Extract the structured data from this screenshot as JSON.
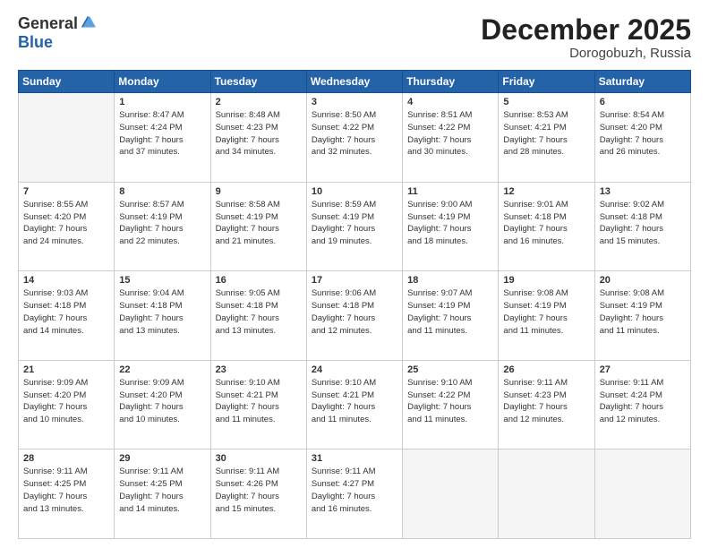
{
  "header": {
    "logo_line1": "General",
    "logo_line2": "Blue",
    "month": "December 2025",
    "location": "Dorogobuzh, Russia"
  },
  "weekdays": [
    "Sunday",
    "Monday",
    "Tuesday",
    "Wednesday",
    "Thursday",
    "Friday",
    "Saturday"
  ],
  "weeks": [
    [
      {
        "day": "",
        "info": ""
      },
      {
        "day": "1",
        "info": "Sunrise: 8:47 AM\nSunset: 4:24 PM\nDaylight: 7 hours\nand 37 minutes."
      },
      {
        "day": "2",
        "info": "Sunrise: 8:48 AM\nSunset: 4:23 PM\nDaylight: 7 hours\nand 34 minutes."
      },
      {
        "day": "3",
        "info": "Sunrise: 8:50 AM\nSunset: 4:22 PM\nDaylight: 7 hours\nand 32 minutes."
      },
      {
        "day": "4",
        "info": "Sunrise: 8:51 AM\nSunset: 4:22 PM\nDaylight: 7 hours\nand 30 minutes."
      },
      {
        "day": "5",
        "info": "Sunrise: 8:53 AM\nSunset: 4:21 PM\nDaylight: 7 hours\nand 28 minutes."
      },
      {
        "day": "6",
        "info": "Sunrise: 8:54 AM\nSunset: 4:20 PM\nDaylight: 7 hours\nand 26 minutes."
      }
    ],
    [
      {
        "day": "7",
        "info": "Sunrise: 8:55 AM\nSunset: 4:20 PM\nDaylight: 7 hours\nand 24 minutes."
      },
      {
        "day": "8",
        "info": "Sunrise: 8:57 AM\nSunset: 4:19 PM\nDaylight: 7 hours\nand 22 minutes."
      },
      {
        "day": "9",
        "info": "Sunrise: 8:58 AM\nSunset: 4:19 PM\nDaylight: 7 hours\nand 21 minutes."
      },
      {
        "day": "10",
        "info": "Sunrise: 8:59 AM\nSunset: 4:19 PM\nDaylight: 7 hours\nand 19 minutes."
      },
      {
        "day": "11",
        "info": "Sunrise: 9:00 AM\nSunset: 4:19 PM\nDaylight: 7 hours\nand 18 minutes."
      },
      {
        "day": "12",
        "info": "Sunrise: 9:01 AM\nSunset: 4:18 PM\nDaylight: 7 hours\nand 16 minutes."
      },
      {
        "day": "13",
        "info": "Sunrise: 9:02 AM\nSunset: 4:18 PM\nDaylight: 7 hours\nand 15 minutes."
      }
    ],
    [
      {
        "day": "14",
        "info": "Sunrise: 9:03 AM\nSunset: 4:18 PM\nDaylight: 7 hours\nand 14 minutes."
      },
      {
        "day": "15",
        "info": "Sunrise: 9:04 AM\nSunset: 4:18 PM\nDaylight: 7 hours\nand 13 minutes."
      },
      {
        "day": "16",
        "info": "Sunrise: 9:05 AM\nSunset: 4:18 PM\nDaylight: 7 hours\nand 13 minutes."
      },
      {
        "day": "17",
        "info": "Sunrise: 9:06 AM\nSunset: 4:18 PM\nDaylight: 7 hours\nand 12 minutes."
      },
      {
        "day": "18",
        "info": "Sunrise: 9:07 AM\nSunset: 4:19 PM\nDaylight: 7 hours\nand 11 minutes."
      },
      {
        "day": "19",
        "info": "Sunrise: 9:08 AM\nSunset: 4:19 PM\nDaylight: 7 hours\nand 11 minutes."
      },
      {
        "day": "20",
        "info": "Sunrise: 9:08 AM\nSunset: 4:19 PM\nDaylight: 7 hours\nand 11 minutes."
      }
    ],
    [
      {
        "day": "21",
        "info": "Sunrise: 9:09 AM\nSunset: 4:20 PM\nDaylight: 7 hours\nand 10 minutes."
      },
      {
        "day": "22",
        "info": "Sunrise: 9:09 AM\nSunset: 4:20 PM\nDaylight: 7 hours\nand 10 minutes."
      },
      {
        "day": "23",
        "info": "Sunrise: 9:10 AM\nSunset: 4:21 PM\nDaylight: 7 hours\nand 11 minutes."
      },
      {
        "day": "24",
        "info": "Sunrise: 9:10 AM\nSunset: 4:21 PM\nDaylight: 7 hours\nand 11 minutes."
      },
      {
        "day": "25",
        "info": "Sunrise: 9:10 AM\nSunset: 4:22 PM\nDaylight: 7 hours\nand 11 minutes."
      },
      {
        "day": "26",
        "info": "Sunrise: 9:11 AM\nSunset: 4:23 PM\nDaylight: 7 hours\nand 12 minutes."
      },
      {
        "day": "27",
        "info": "Sunrise: 9:11 AM\nSunset: 4:24 PM\nDaylight: 7 hours\nand 12 minutes."
      }
    ],
    [
      {
        "day": "28",
        "info": "Sunrise: 9:11 AM\nSunset: 4:25 PM\nDaylight: 7 hours\nand 13 minutes."
      },
      {
        "day": "29",
        "info": "Sunrise: 9:11 AM\nSunset: 4:25 PM\nDaylight: 7 hours\nand 14 minutes."
      },
      {
        "day": "30",
        "info": "Sunrise: 9:11 AM\nSunset: 4:26 PM\nDaylight: 7 hours\nand 15 minutes."
      },
      {
        "day": "31",
        "info": "Sunrise: 9:11 AM\nSunset: 4:27 PM\nDaylight: 7 hours\nand 16 minutes."
      },
      {
        "day": "",
        "info": ""
      },
      {
        "day": "",
        "info": ""
      },
      {
        "day": "",
        "info": ""
      }
    ]
  ]
}
